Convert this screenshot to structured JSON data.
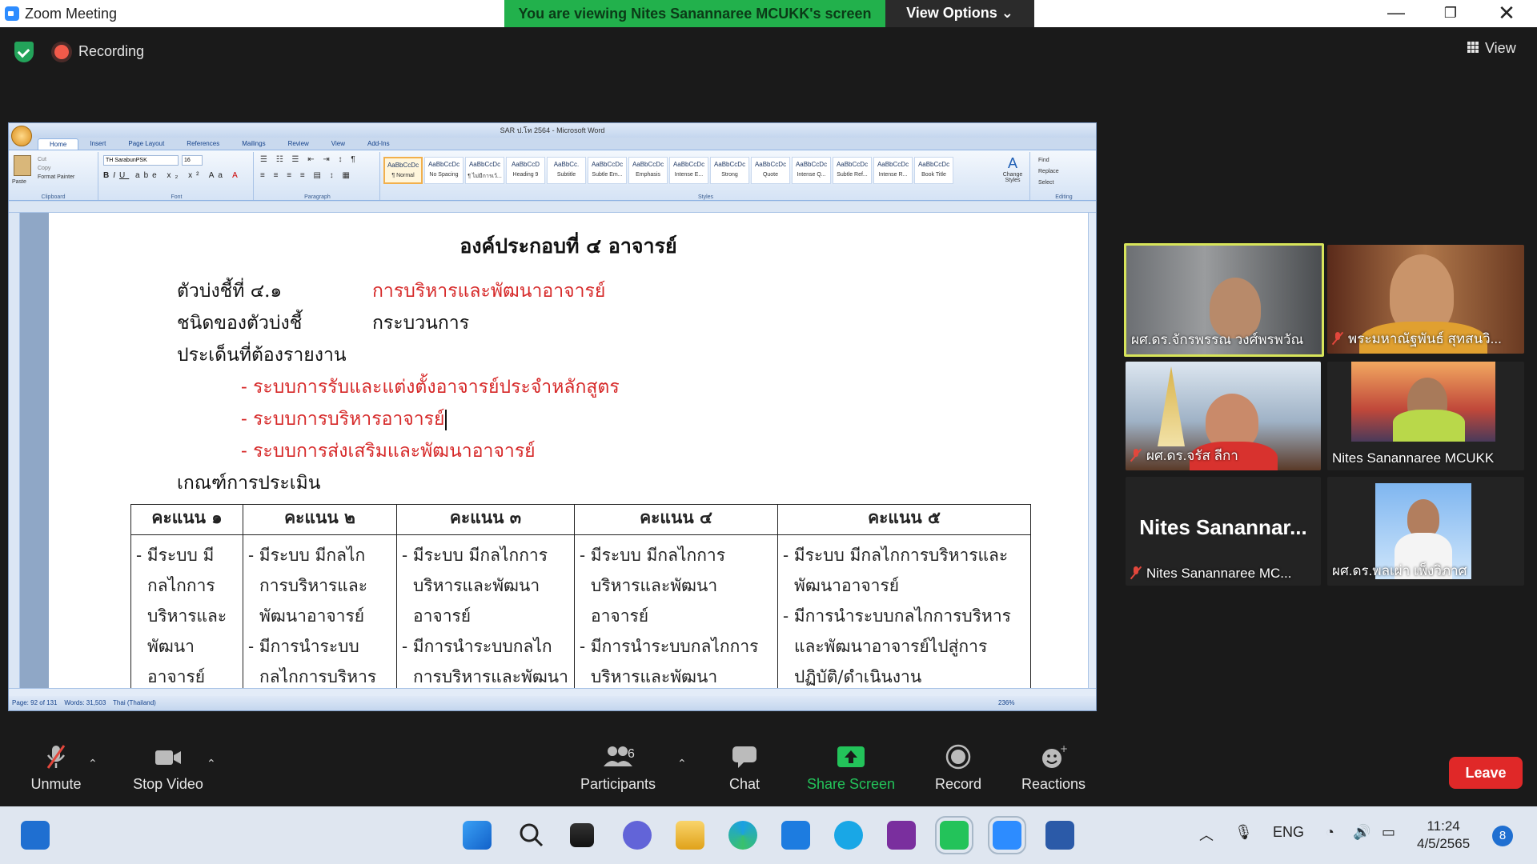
{
  "window": {
    "title": "Zoom Meeting",
    "banner": "You are viewing Nites Sanannaree MCUKK's screen",
    "view_options": "View Options"
  },
  "topbar": {
    "recording": "Recording",
    "view": "View"
  },
  "word": {
    "title": "SAR ป.โท 2564 - Microsoft Word",
    "tabs": [
      "Home",
      "Insert",
      "Page Layout",
      "References",
      "Mailings",
      "Review",
      "View",
      "Add-Ins"
    ],
    "groups": [
      "Clipboard",
      "Font",
      "Paragraph",
      "Styles",
      "Editing"
    ],
    "font_name": "TH SarabunPSK",
    "font_size": "16",
    "clipboard": [
      "Cut",
      "Copy",
      "Format Painter"
    ],
    "paste": "Paste",
    "styles": [
      {
        "sample": "AaBbCcDc",
        "name": "¶ Normal"
      },
      {
        "sample": "AaBbCcDc",
        "name": "No Spacing"
      },
      {
        "sample": "AaBbCcDc",
        "name": "¶ ไม่มีการเว้..."
      },
      {
        "sample": "AaBbCcD",
        "name": "Heading 9"
      },
      {
        "sample": "AaBbCc.",
        "name": "Subtitle"
      },
      {
        "sample": "AaBbCcDc",
        "name": "Subtle Em..."
      },
      {
        "sample": "AaBbCcDc",
        "name": "Emphasis"
      },
      {
        "sample": "AaBbCcDc",
        "name": "Intense E..."
      },
      {
        "sample": "AaBbCcDc",
        "name": "Strong"
      },
      {
        "sample": "AaBbCcDc",
        "name": "Quote"
      },
      {
        "sample": "AaBbCcDc",
        "name": "Intense Q..."
      },
      {
        "sample": "AaBbCcDc",
        "name": "Subtle Ref..."
      },
      {
        "sample": "AaBbCcDc",
        "name": "Intense R..."
      },
      {
        "sample": "AaBbCcDc",
        "name": "Book Title"
      }
    ],
    "change_styles": "Change Styles",
    "editing": [
      "Find",
      "Replace",
      "Select"
    ],
    "status": {
      "page": "Page: 92 of 131",
      "words": "Words: 31,503",
      "language": "Thai (Thailand)",
      "zoom": "236%"
    }
  },
  "doc": {
    "title": "องค์ประกอบที่ ๔ อาจารย์",
    "indicator_label": "ตัวบ่งชี้ที่ ๔.๑",
    "indicator_value": "การบริหารและพัฒนาอาจารย์",
    "type_label": "ชนิดของตัวบ่งชี้",
    "type_value": "กระบวนการ",
    "issues_label": "ประเด็นที่ต้องรายงาน",
    "issues": [
      "- ระบบการรับและแต่งตั้งอาจารย์ประจำหลักสูตร",
      "- ระบบการบริหารอาจารย์",
      "- ระบบการส่งเสริมและพัฒนาอาจารย์"
    ],
    "criteria_label": "เกณฑ์การประเมิน",
    "table": {
      "headers": [
        "คะแนน ๑",
        "คะแนน ๒",
        "คะแนน ๓",
        "คะแนน ๔",
        "คะแนน ๕"
      ],
      "cells": [
        [
          "- มีระบบ มี",
          "กลไกการ",
          "บริหารและ",
          "พัฒนา",
          "อาจารย์"
        ],
        [
          "- มีระบบ มีกลไก",
          "การบริหารและ",
          "พัฒนาอาจารย์",
          "- มีการนำระบบ",
          "กลไกการบริหาร"
        ],
        [
          "- มีระบบ มีกลไกการ",
          "บริหารและพัฒนา",
          "อาจารย์",
          "- มีการนำระบบกลไก",
          "การบริหารและพัฒนา"
        ],
        [
          "- มีระบบ มีกลไกการ",
          "บริหารและพัฒนา",
          "อาจารย์",
          "- มีการนำระบบกลไกการ",
          "บริหารและพัฒนา"
        ],
        [
          "- มีระบบ มีกลไกการบริหารและ",
          "พัฒนาอาจารย์",
          "- มีการนำระบบกลไกการบริหาร",
          "และพัฒนาอาจารย์ไปสู่การ",
          "ปฏิบัติ/ดำเนินงาน"
        ]
      ]
    }
  },
  "participants": [
    {
      "name": "ผศ.ดร.จักรพรรณ วงศ์พรพวัณ",
      "muted": false,
      "active": true
    },
    {
      "name": "พระมหาณัฐพันธ์ สุทสนวิ...",
      "muted": true,
      "active": false
    },
    {
      "name": "ผศ.ดร.จรัส ลีกา",
      "muted": true,
      "active": false
    },
    {
      "name": "Nites Sanannaree MCUKK",
      "muted": false,
      "active": false
    },
    {
      "name": "Nites Sanannaree MC...",
      "muted": true,
      "active": false,
      "big_name": "Nites  Sanannar..."
    },
    {
      "name": "ผศ.ดร.พลเผ่า เพ็งวิภาศ",
      "muted": false,
      "active": false
    }
  ],
  "toolbar": {
    "unmute": "Unmute",
    "stop_video": "Stop Video",
    "participants": "Participants",
    "participant_count": "6",
    "chat": "Chat",
    "share_screen": "Share Screen",
    "record": "Record",
    "reactions": "Reactions",
    "leave": "Leave"
  },
  "taskbar": {
    "lang": "ENG",
    "time": "11:24",
    "date": "4/5/2565",
    "notifications": "8"
  },
  "colors": {
    "banner_green": "#22b14c",
    "leave_red": "#e02828",
    "share_green": "#23c35a",
    "doc_red": "#d62828",
    "active_speaker": "#d7e45a"
  }
}
